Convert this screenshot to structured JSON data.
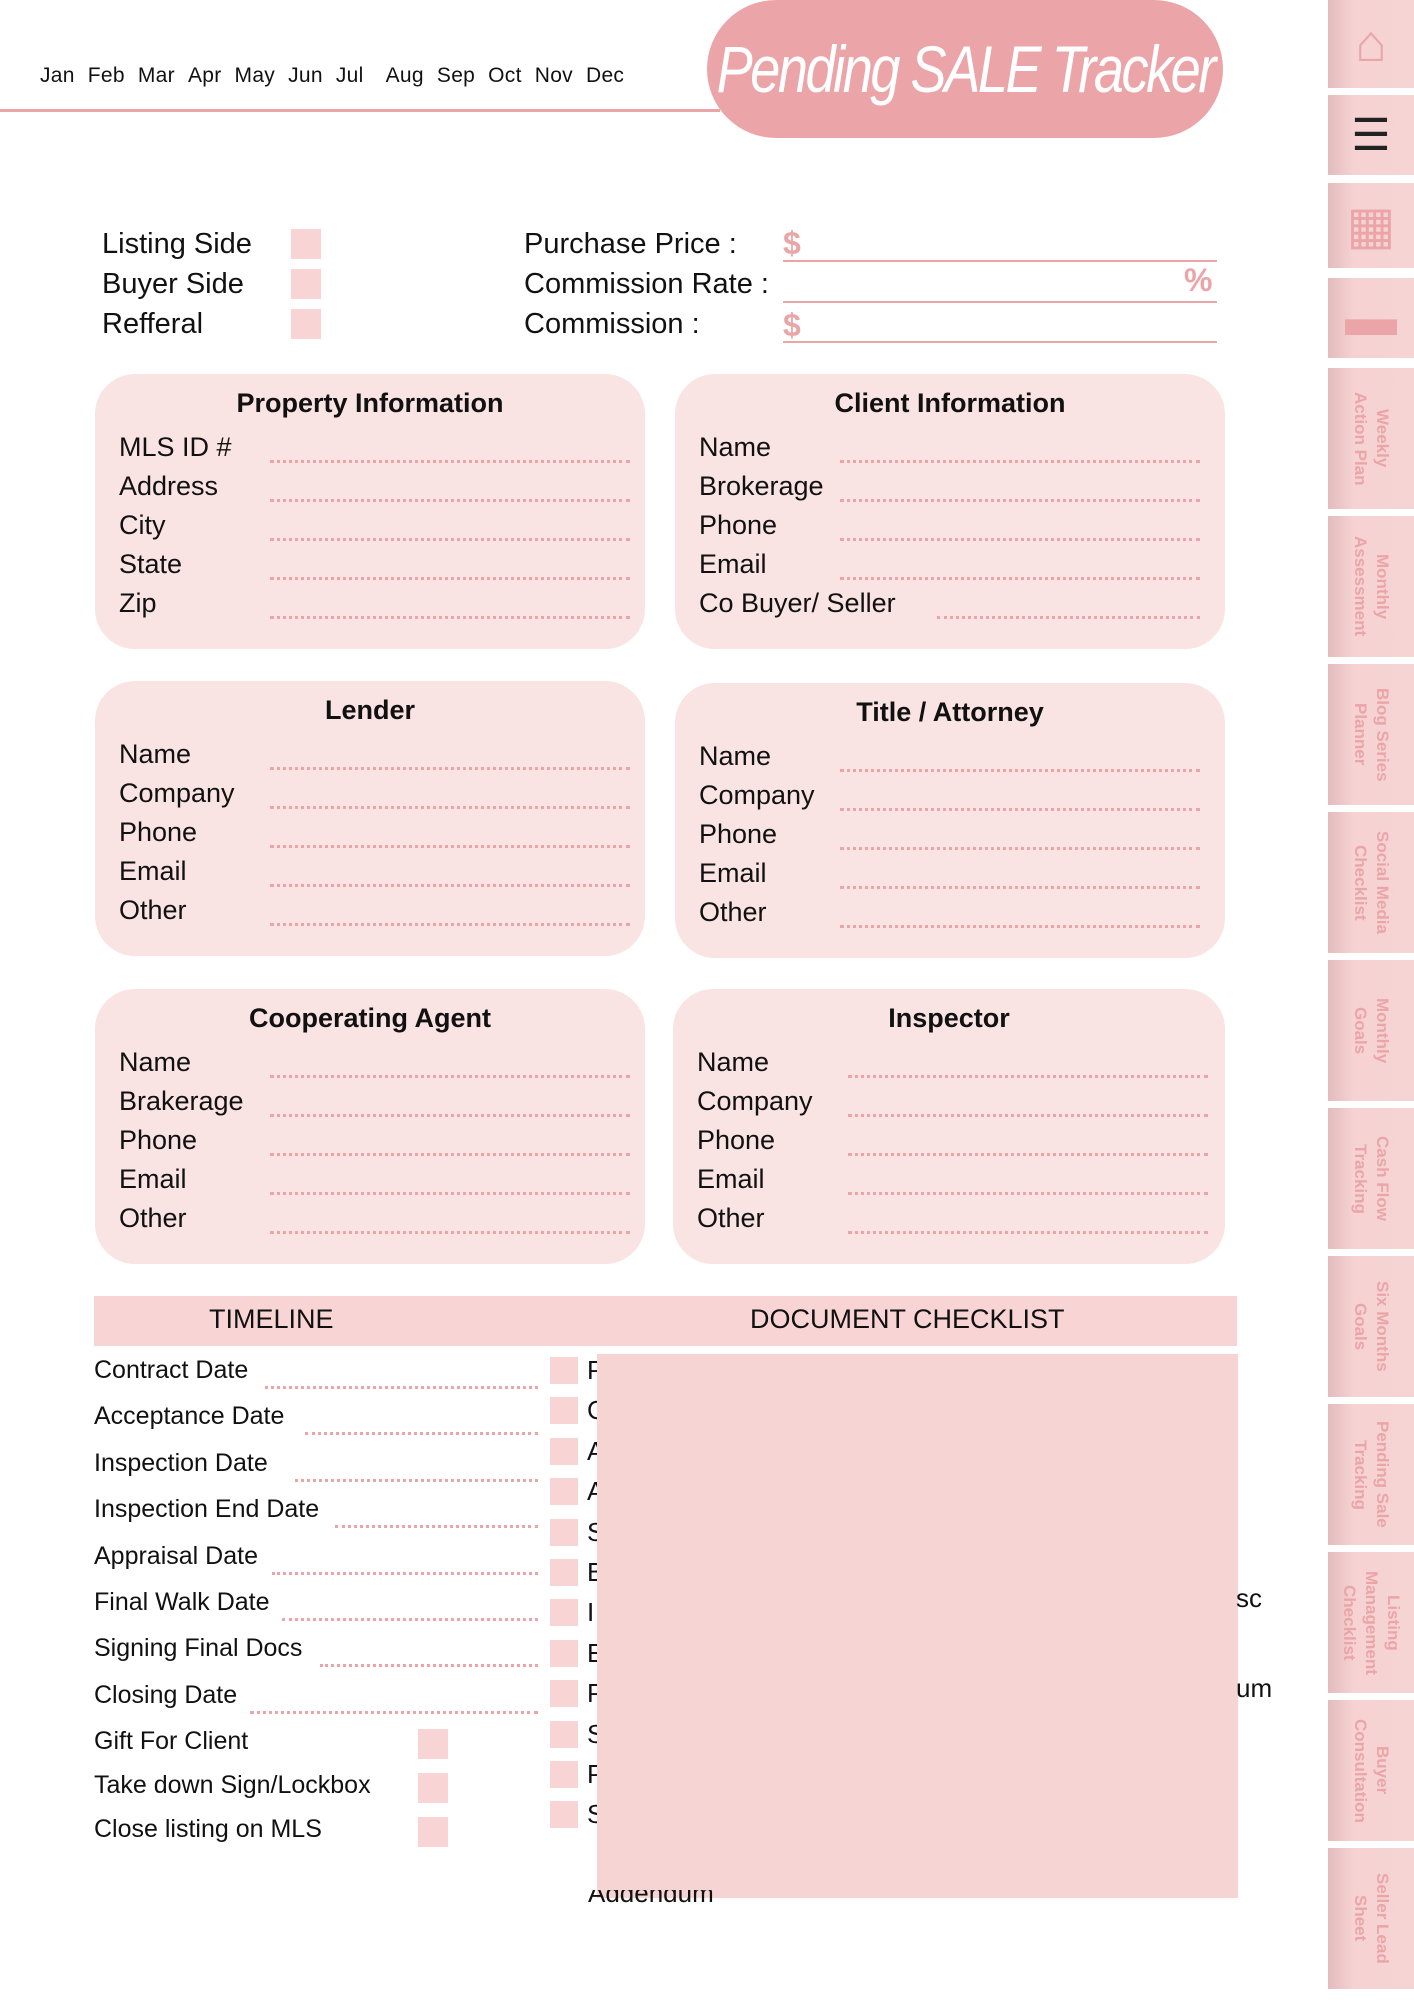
{
  "header": {
    "months": [
      "Jan",
      "Feb",
      "Mar",
      "Apr",
      "May",
      "Jun",
      "Jul",
      "Aug",
      "Sep",
      "Oct",
      "Nov",
      "Dec"
    ],
    "title": "Pending SALE Tracker"
  },
  "colors": {
    "accent": "#eba5a8",
    "card_bg": "#f9e3e3",
    "band_bg": "#f8d4d4"
  },
  "sidebar": {
    "icon_tabs": [
      "home-icon",
      "menu-icon",
      "calendar-icon",
      "notepad-icon"
    ],
    "tabs": [
      "Weekly\nAction Plan",
      "Monthly\nAssessment",
      "Blog Series\nPlanner",
      "Social Media\nChecklist",
      "Monthly\nGoals",
      "Cash Flow\nTracking",
      "Six Months\nGoals",
      "Pending Sale\nTracking",
      "Listing\nManagement\nChecklist",
      "Buyer\nConsultation",
      "Seller Lead\nSheet"
    ]
  },
  "deal_type": [
    "Listing Side",
    "Buyer Side",
    "Refferal"
  ],
  "money": {
    "purchase_price": "Purchase Price :",
    "commission_rate": "Commission Rate :",
    "commission": "Commission :",
    "dollar": "$",
    "percent": "%"
  },
  "cards": [
    {
      "title": "Property Information",
      "rows": [
        "MLS ID #",
        "Address",
        "City",
        "State",
        "Zip"
      ]
    },
    {
      "title": "Client Information",
      "rows": [
        "Name",
        "Brokerage",
        "Phone",
        "Email",
        "Co Buyer/ Seller"
      ]
    },
    {
      "title": "Lender",
      "rows": [
        "Name",
        "Company",
        "Phone",
        "Email",
        "Other"
      ]
    },
    {
      "title": "Title / Attorney",
      "rows": [
        "Name",
        "Company",
        "Phone",
        "Email",
        "Other"
      ]
    },
    {
      "title": "Cooperating Agent",
      "rows": [
        "Name",
        "Brakerage",
        "Phone",
        "Email",
        "Other"
      ]
    },
    {
      "title": "Inspector",
      "rows": [
        "Name",
        "Company",
        "Phone",
        "Email",
        "Other"
      ]
    }
  ],
  "timeline": {
    "header": "TIMELINE",
    "dates": [
      "Contract Date",
      "Acceptance Date",
      "Inspection Date",
      "Inspection End Date",
      "Appraisal Date",
      "Final Walk Date",
      "Signing Final Docs",
      "Closing Date"
    ],
    "tasks": [
      "Gift For Client",
      "Take down Sign/Lockbox",
      "Close listing on MLS"
    ]
  },
  "checklist": {
    "header": "DOCUMENT CHECKLIST",
    "visible_initials": [
      "P",
      "C",
      "A",
      "A",
      "S",
      "B",
      "I",
      "E",
      "P",
      "S",
      "P",
      "S"
    ],
    "fragments": {
      "row6_end": "sc",
      "row8_end": "um",
      "last_line": "Addendum"
    }
  }
}
